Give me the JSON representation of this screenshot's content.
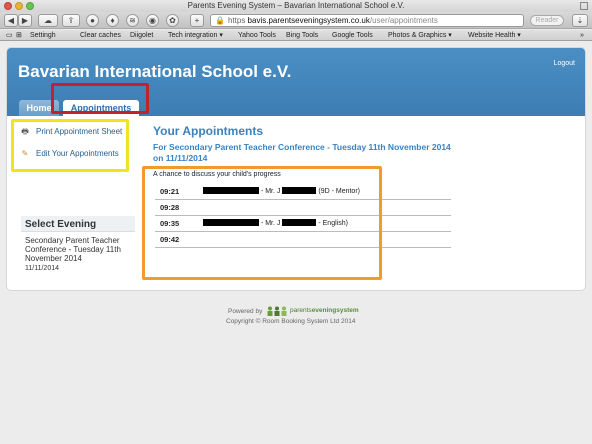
{
  "window": {
    "title": "Parents Evening System – Bavarian International School e.V."
  },
  "toolbar": {
    "url_https": "https",
    "url_domain": "bavis.parentseveningsystem.co.uk",
    "url_path": "/user/appointments",
    "reader_label": "Reader"
  },
  "bookmarks": [
    {
      "label": "Settingh"
    },
    {
      "label": "Clear caches"
    },
    {
      "label": "Diigolet"
    },
    {
      "label": "Tech integration ▾"
    },
    {
      "label": "Yahoo Tools"
    },
    {
      "label": "Bing Tools"
    },
    {
      "label": "Google Tools"
    },
    {
      "label": "Photos & Graphics ▾"
    },
    {
      "label": "Website Health ▾"
    }
  ],
  "header": {
    "school_name": "Bavarian International School e.V.",
    "logout_label": "Logout",
    "tabs": [
      {
        "label": "Home"
      },
      {
        "label": "Appointments"
      }
    ]
  },
  "sidebar": {
    "print_label": "Print Appointment Sheet",
    "edit_label": "Edit Your Appointments",
    "select_evening_heading": "Select Evening",
    "evening_name": "Secondary Parent Teacher Conference - Tuesday 11th November 2014",
    "evening_date": "11/11/2014"
  },
  "main": {
    "title": "Your Appointments",
    "conference": "For Secondary Parent Teacher Conference - Tuesday 11th November 2014 on 11/11/2014",
    "intro": "A chance to discuss your child's progress",
    "appointments": [
      {
        "time": "09:21",
        "teacher_prefix": "- Mr. J",
        "detail": "(9D - Mentor)"
      },
      {
        "time": "09:28",
        "teacher_prefix": "",
        "detail": ""
      },
      {
        "time": "09:35",
        "teacher_prefix": "- Mr. J",
        "detail": "- English)"
      },
      {
        "time": "09:42",
        "teacher_prefix": "",
        "detail": ""
      }
    ]
  },
  "footer": {
    "powered_by": "Powered by",
    "brand_prefix": "parents",
    "brand_suffix": "eveningsystem",
    "copyright": "Copyright © Room Booking System Ltd 2014"
  },
  "colors": {
    "header_blue": "#3d7db4",
    "link_blue": "#3a82bf",
    "highlight_red": "#c0242a",
    "highlight_yellow": "#f2e21f",
    "highlight_orange": "#f39a2e"
  }
}
